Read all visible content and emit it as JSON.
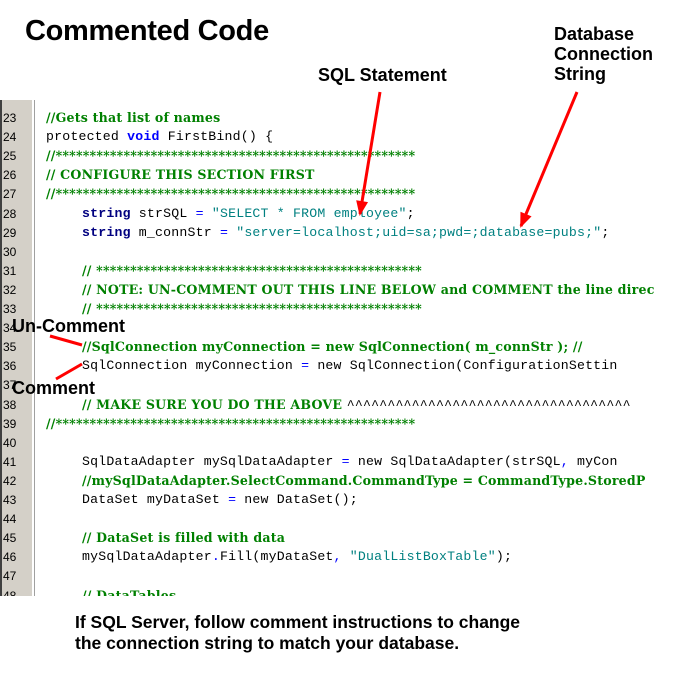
{
  "title": "Commented Code",
  "annotations": {
    "sql_statement": "SQL Statement",
    "db_connection": [
      "Database",
      "Connection",
      "String"
    ],
    "un_comment": "Un-Comment",
    "comment": "Comment",
    "arrow_color": "#ff0000"
  },
  "editor": {
    "lines": [
      {
        "n": "23",
        "indent": 0,
        "parts": [
          {
            "t": "c",
            "v": "//Gets that list of names"
          }
        ]
      },
      {
        "n": "24",
        "indent": 0,
        "parts": [
          {
            "t": "p",
            "v": "protected "
          },
          {
            "t": "k",
            "v": "void"
          },
          {
            "t": "p",
            "v": " FirstBind() {"
          }
        ]
      },
      {
        "n": "25",
        "indent": 0,
        "parts": [
          {
            "t": "c",
            "v": "//*****************************************************"
          }
        ]
      },
      {
        "n": "26",
        "indent": 0,
        "parts": [
          {
            "t": "c",
            "v": "// CONFIGURE THIS SECTION FIRST"
          }
        ]
      },
      {
        "n": "27",
        "indent": 0,
        "parts": [
          {
            "t": "c",
            "v": "//*****************************************************"
          }
        ]
      },
      {
        "n": "28",
        "indent": 1,
        "parts": [
          {
            "t": "kd",
            "v": "string"
          },
          {
            "t": "p",
            "v": " strSQL "
          },
          {
            "t": "op",
            "v": "="
          },
          {
            "t": "p",
            "v": " "
          },
          {
            "t": "s",
            "v": "\"SELECT * FROM employee\""
          },
          {
            "t": "p",
            "v": ";"
          }
        ]
      },
      {
        "n": "29",
        "indent": 1,
        "parts": [
          {
            "t": "kd",
            "v": "string"
          },
          {
            "t": "p",
            "v": " m_connStr "
          },
          {
            "t": "op",
            "v": "="
          },
          {
            "t": "p",
            "v": " "
          },
          {
            "t": "s",
            "v": "\"server=localhost;uid=sa;pwd=;database=pubs;\""
          },
          {
            "t": "p",
            "v": ";"
          }
        ]
      },
      {
        "n": "30",
        "indent": 0,
        "parts": []
      },
      {
        "n": "31",
        "indent": 1,
        "parts": [
          {
            "t": "c",
            "v": "// ************************************************"
          }
        ]
      },
      {
        "n": "32",
        "indent": 1,
        "parts": [
          {
            "t": "c",
            "v": "// NOTE: UN-COMMENT OUT THIS LINE BELOW and COMMENT the line direc"
          }
        ]
      },
      {
        "n": "33",
        "indent": 1,
        "parts": [
          {
            "t": "c",
            "v": "// ************************************************"
          }
        ]
      },
      {
        "n": "34",
        "indent": 0,
        "parts": []
      },
      {
        "n": "35",
        "indent": 1,
        "parts": [
          {
            "t": "c",
            "v": "//SqlConnection myConnection = new SqlConnection( m_connStr ); //"
          }
        ]
      },
      {
        "n": "36",
        "indent": 1,
        "parts": [
          {
            "t": "p",
            "v": "SqlConnection myConnection "
          },
          {
            "t": "op",
            "v": "="
          },
          {
            "t": "p",
            "v": " new SqlConnection(ConfigurationSettin"
          }
        ]
      },
      {
        "n": "37",
        "indent": 0,
        "parts": []
      },
      {
        "n": "38",
        "indent": 1,
        "parts": [
          {
            "t": "c",
            "v": "// MAKE SURE YOU DO THE ABOVE "
          },
          {
            "t": "p",
            "v": "^^^^^^^^^^^^^^^^^^^^^^^^^^^^^^^^^^^"
          }
        ]
      },
      {
        "n": "39",
        "indent": 0,
        "parts": [
          {
            "t": "c",
            "v": "//*****************************************************"
          }
        ]
      },
      {
        "n": "40",
        "indent": 0,
        "parts": []
      },
      {
        "n": "41",
        "indent": 1,
        "parts": [
          {
            "t": "p",
            "v": "SqlDataAdapter mySqlDataAdapter "
          },
          {
            "t": "op",
            "v": "="
          },
          {
            "t": "p",
            "v": " new SqlDataAdapter(strSQL"
          },
          {
            "t": "op",
            "v": ","
          },
          {
            "t": "p",
            "v": " myCon"
          }
        ]
      },
      {
        "n": "42",
        "indent": 1,
        "parts": [
          {
            "t": "c",
            "v": "//mySqlDataAdapter.SelectCommand.CommandType = CommandType.StoredP"
          }
        ]
      },
      {
        "n": "43",
        "indent": 1,
        "parts": [
          {
            "t": "p",
            "v": "DataSet myDataSet "
          },
          {
            "t": "op",
            "v": "="
          },
          {
            "t": "p",
            "v": " new DataSet();"
          }
        ]
      },
      {
        "n": "44",
        "indent": 0,
        "parts": []
      },
      {
        "n": "45",
        "indent": 1,
        "parts": [
          {
            "t": "c",
            "v": "// DataSet is filled with data"
          }
        ]
      },
      {
        "n": "46",
        "indent": 1,
        "parts": [
          {
            "t": "p",
            "v": "mySqlDataAdapter"
          },
          {
            "t": "op",
            "v": "."
          },
          {
            "t": "p",
            "v": "Fill(myDataSet"
          },
          {
            "t": "op",
            "v": ","
          },
          {
            "t": "p",
            "v": " "
          },
          {
            "t": "s",
            "v": "\"DualListBoxTable\""
          },
          {
            "t": "p",
            "v": ");"
          }
        ]
      },
      {
        "n": "47",
        "indent": 0,
        "parts": []
      },
      {
        "n": "48",
        "indent": 1,
        "parts": [
          {
            "t": "c",
            "v": "// DataTables"
          }
        ]
      }
    ]
  },
  "footer_note": [
    "If SQL Server, follow comment instructions to change",
    "the connection string to match your database."
  ]
}
